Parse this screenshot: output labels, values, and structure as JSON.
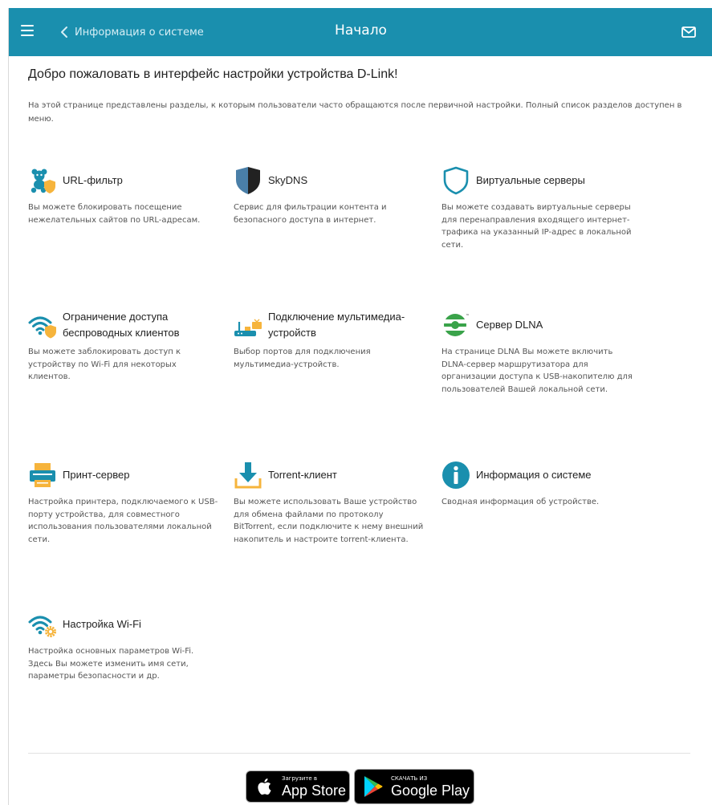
{
  "header": {
    "back_label": "Информация о системе",
    "title": "Начало",
    "icons": [
      "menu-icon",
      "chevron-left-icon",
      "mail-icon"
    ]
  },
  "welcome_title": "Добро пожаловать в интерфейс настройки устройства D-Link!",
  "intro_text": "На этой странице представлены разделы, к которым пользователи часто обращаются после первичной настройки. Полный список разделов доступен в меню.",
  "cards": [
    {
      "title": "URL-фильтр",
      "desc": "Вы можете блокировать посещение нежелательных сайтов по URL-адресам.",
      "icon": "teddy-bear-shield-icon"
    },
    {
      "title": "SkyDNS",
      "desc": "Сервис для фильтрации контента и безопасного доступа в интернет.",
      "icon": "skydns-shield-icon"
    },
    {
      "title": "Виртуальные серверы",
      "desc": "Вы можете создавать виртуальные серверы для перенаправления входящего интернет-трафика на указанный IP-адрес в локальной сети.",
      "icon": "shield-outline-icon"
    },
    {
      "title": "Ограничение доступа беспроводных клиентов",
      "desc": "Вы можете заблокировать доступ к устройству по Wi-Fi для некоторых клиентов.",
      "icon": "wifi-shield-icon"
    },
    {
      "title": "Подключение мультимедиа-устройств",
      "desc": "Выбор портов для подключения мультимедиа-устройств.",
      "icon": "router-tv-icon"
    },
    {
      "title": "Сервер DLNA",
      "desc": "На странице DLNA Вы можете включить DLNA-сервер маршрутизатора для организации доступа к USB-накопителю для пользователей Вашей локальной сети.",
      "icon": "dlna-icon"
    },
    {
      "title": "Принт-сервер",
      "desc": "Настройка принтера, подключаемого к USB-порту устройства, для совместного использования пользователями локальной сети.",
      "icon": "printer-icon"
    },
    {
      "title": "Torrent-клиент",
      "desc": "Вы можете использовать Ваше устройство для обмена файлами по протоколу BitTorrent, если подключите к нему внешний накопитель и настроите torrent-клиента.",
      "icon": "download-icon"
    },
    {
      "title": "Информация о системе",
      "desc": "Сводная информация об устройстве.",
      "icon": "info-icon"
    },
    {
      "title": "Настройка Wi-Fi",
      "desc": "Настройка основных параметров Wi-Fi. Здесь Вы можете изменить имя сети, параметры безопасности и др.",
      "icon": "wifi-gear-icon"
    }
  ],
  "app_store": {
    "small": "Загрузите в",
    "big": "App Store"
  },
  "google_play": {
    "small": "СКАЧАТЬ ИЗ",
    "big": "Google Play"
  },
  "colors": {
    "header": "#1a8fae",
    "accent_blue": "#1a8fae",
    "shield_gold": "#f6b43c",
    "dlna_green": "#3aa34a"
  }
}
